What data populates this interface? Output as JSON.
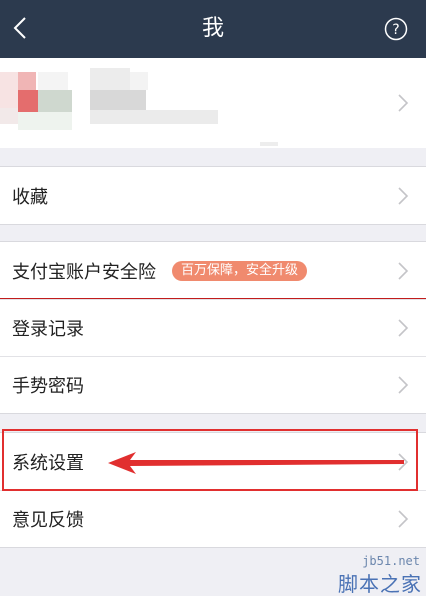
{
  "navbar": {
    "title": "我",
    "back_icon": "chevron-left-icon",
    "help_icon": "question-circle-icon"
  },
  "profile": {
    "chevron_icon": "chevron-right-icon"
  },
  "sections": {
    "favorites": {
      "label": "收藏"
    },
    "insurance": {
      "label": "支付宝账户安全险",
      "badge": "百万保障，安全升级"
    },
    "login_records": {
      "label": "登录记录"
    },
    "gesture_password": {
      "label": "手势密码"
    },
    "system_settings": {
      "label": "系统设置"
    },
    "feedback": {
      "label": "意见反馈"
    }
  },
  "colors": {
    "navbar_bg": "#2c3a4e",
    "badge_bg": "#f08a6e",
    "annotation_red": "#e12f2f",
    "page_bg": "#efeff4"
  },
  "watermark": {
    "url": "jb51.net",
    "name": "脚本之家"
  }
}
